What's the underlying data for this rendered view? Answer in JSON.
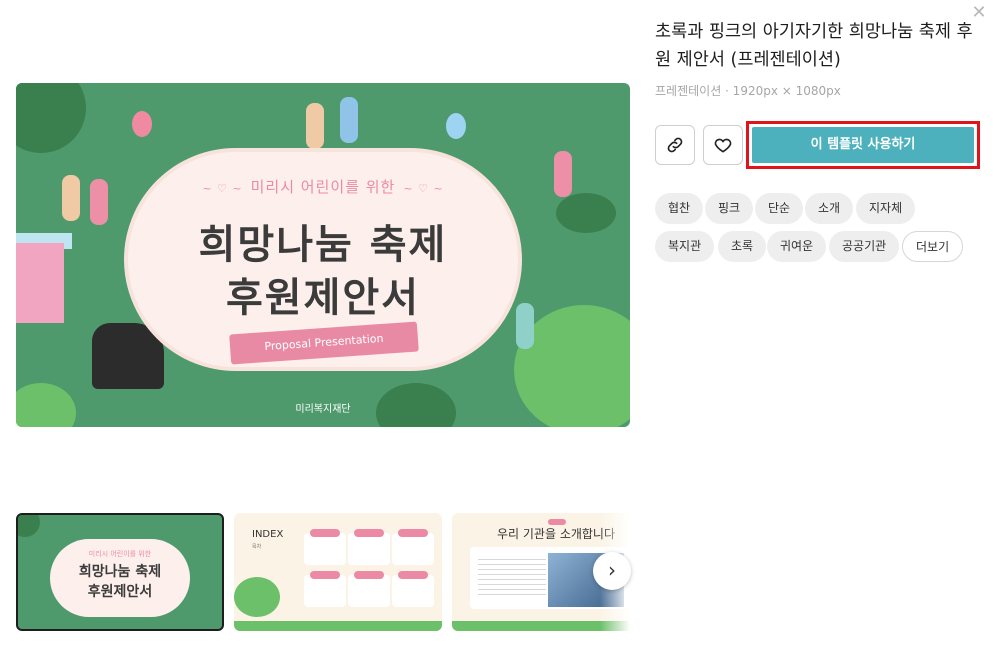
{
  "template": {
    "title": "초록과 핑크의 아기자기한 희망나눔 축제 후원 제안서 (프레젠테이션)",
    "meta": "프레젠테이션 · 1920px × 1080px"
  },
  "actions": {
    "use_template_label": "이 템플릿 사용하기",
    "link_icon": "link-icon",
    "heart_icon": "heart-icon",
    "close_icon": "close-icon"
  },
  "tags": [
    "협찬",
    "핑크",
    "단순",
    "소개",
    "지자체",
    "복지관",
    "초록",
    "귀여운",
    "공공기관"
  ],
  "more_label": "더보기",
  "preview": {
    "subtitle": "미리시 어린이를 위한",
    "title_line1": "희망나눔 축제",
    "title_line2": "후원제안서",
    "ribbon": "Proposal Presentation",
    "org": "미리복지재단"
  },
  "thumbnails": {
    "t1": {
      "subtitle": "미리시 어린이를 위한",
      "line1": "희망나눔 축제",
      "line2": "후원제안서"
    },
    "t2": {
      "index": "INDEX",
      "index_sub": "목차"
    },
    "t3": {
      "heading": "우리 기관을 소개합니다"
    }
  },
  "colors": {
    "accent": "#4cb1bc",
    "highlight_border": "#e2141b",
    "slide_green": "#4e9a6d",
    "slide_pink": "#ec8aa6"
  }
}
